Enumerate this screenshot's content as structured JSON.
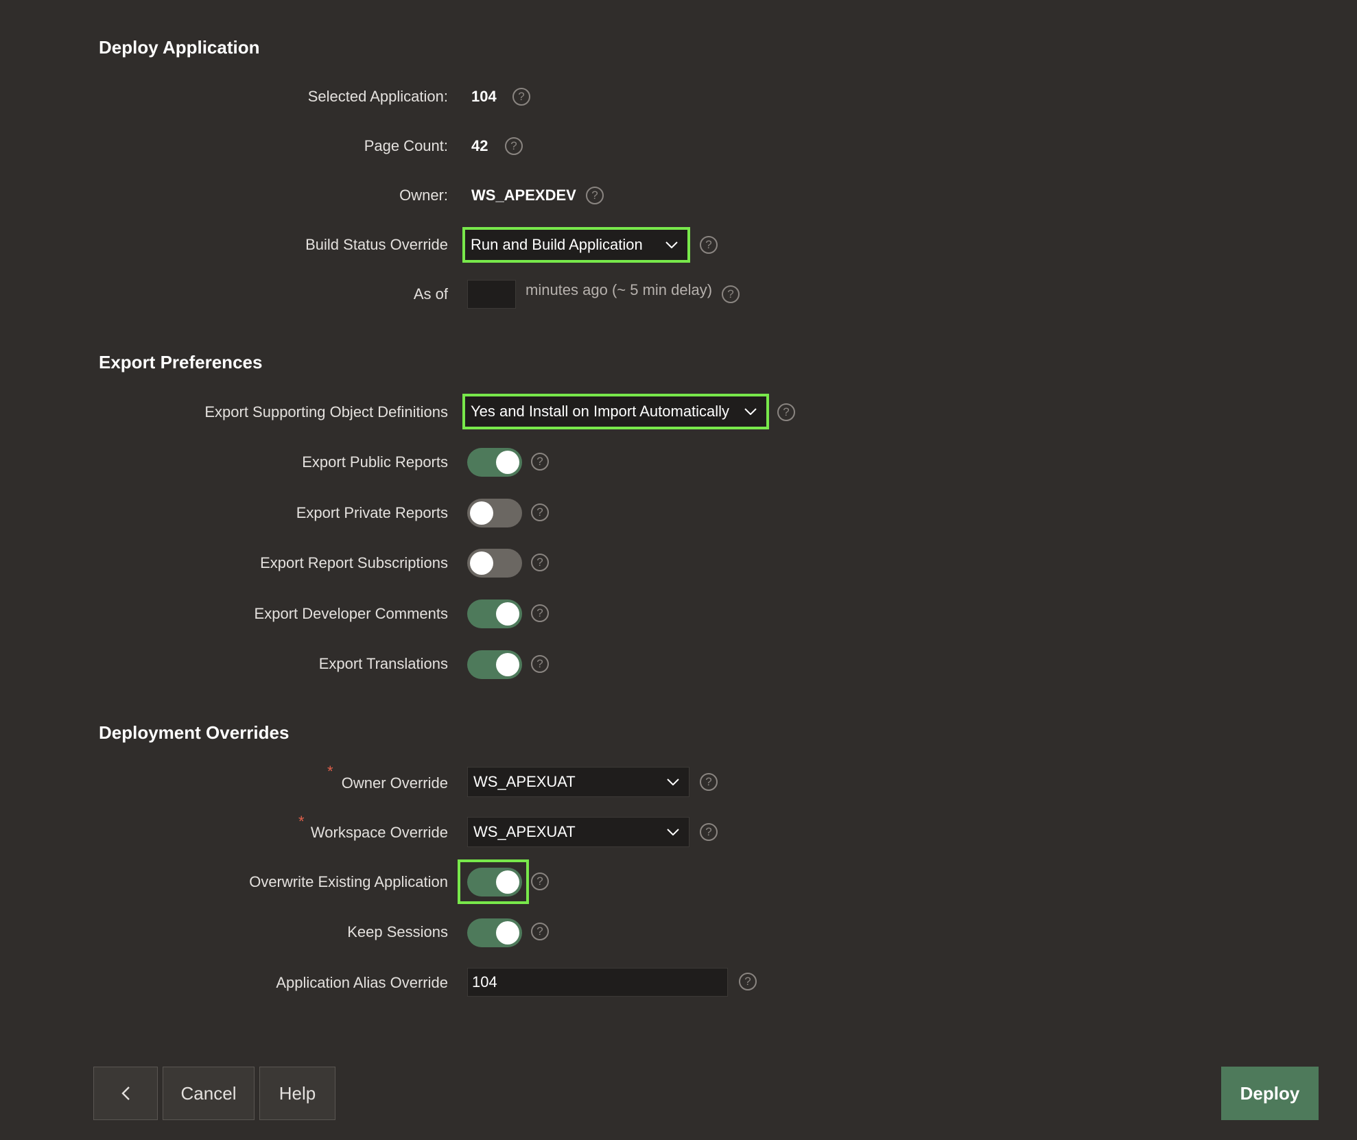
{
  "sections": {
    "deploy_title": "Deploy Application",
    "export_title": "Export Preferences",
    "overrides_title": "Deployment Overrides"
  },
  "deploy": {
    "selected_app_label": "Selected Application:",
    "selected_app_value": "104",
    "page_count_label": "Page Count:",
    "page_count_value": "42",
    "owner_label": "Owner:",
    "owner_value": "WS_APEXDEV",
    "build_status_label": "Build Status Override",
    "build_status_value": "Run and Build Application",
    "as_of_label": "As of",
    "as_of_value": "",
    "as_of_suffix": "minutes ago (~ 5 min delay)"
  },
  "export": {
    "supporting_objects_label": "Export Supporting Object Definitions",
    "supporting_objects_value": "Yes and Install on Import Automatically",
    "toggles": [
      {
        "label": "Export Public Reports",
        "on": true
      },
      {
        "label": "Export Private Reports",
        "on": false
      },
      {
        "label": "Export Report Subscriptions",
        "on": false
      },
      {
        "label": "Export Developer Comments",
        "on": true
      },
      {
        "label": "Export Translations",
        "on": true
      }
    ]
  },
  "overrides": {
    "required_marker": "*",
    "owner_override_label": "Owner Override",
    "owner_override_value": "WS_APEXUAT",
    "workspace_override_label": "Workspace Override",
    "workspace_override_value": "WS_APEXUAT",
    "overwrite_label": "Overwrite Existing Application",
    "overwrite_on": true,
    "keep_sessions_label": "Keep Sessions",
    "keep_sessions_on": true,
    "alias_label": "Application Alias Override",
    "alias_value": "104"
  },
  "footer": {
    "back_icon": "chevron-left-icon",
    "cancel_label": "Cancel",
    "help_label": "Help",
    "deploy_label": "Deploy"
  },
  "help_glyph": "?",
  "colors": {
    "background": "#302d2b",
    "highlight": "#78e84b",
    "toggle_on": "#4e7a5b",
    "required": "#e0604b"
  }
}
